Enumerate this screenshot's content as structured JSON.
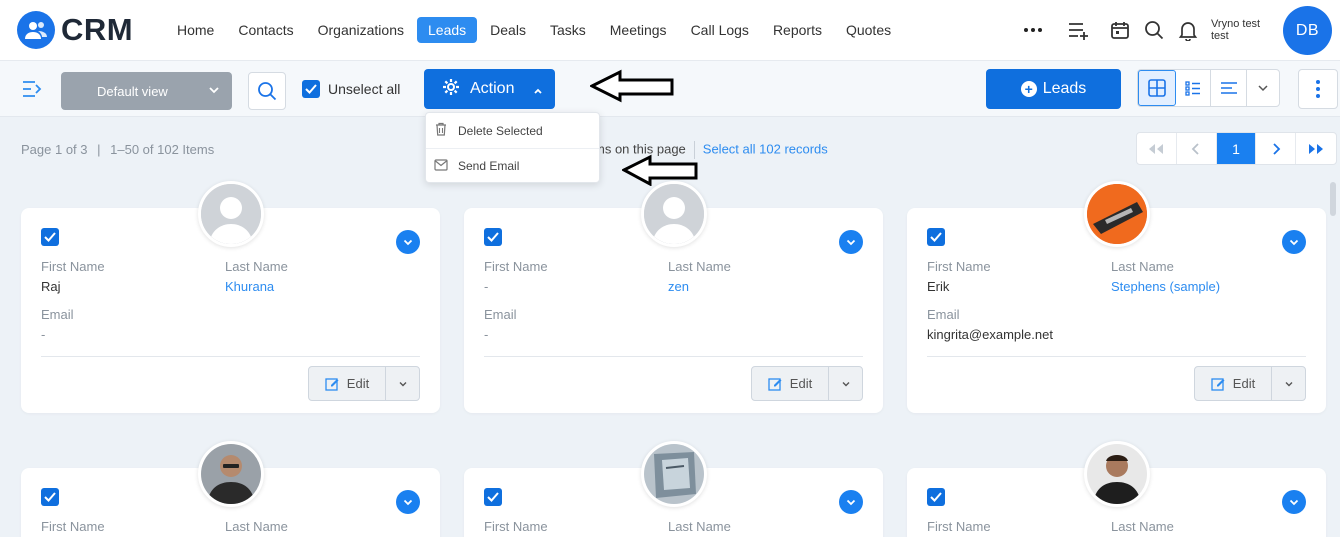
{
  "app": {
    "name": "CRM"
  },
  "nav": {
    "items": [
      "Home",
      "Contacts",
      "Organizations",
      "Leads",
      "Deals",
      "Tasks",
      "Meetings",
      "Call Logs",
      "Reports",
      "Quotes"
    ],
    "active": "Leads"
  },
  "user": {
    "name_line1": "Vryno test",
    "name_line2": "test",
    "initials": "DB"
  },
  "toolbar": {
    "view_select": "Default view",
    "unselect_label": "Unselect all",
    "action_label": "Action",
    "add_label": "Leads"
  },
  "action_menu": {
    "items": [
      "Delete Selected",
      "Send Email"
    ]
  },
  "info": {
    "page": "Page 1 of 3",
    "range": "1–50 of 102 Items",
    "selected_text": "ms on this page",
    "select_all_link": "Select all 102 records"
  },
  "pager": {
    "current": "1"
  },
  "labels": {
    "first_name": "First Name",
    "last_name": "Last Name",
    "email": "Email",
    "edit": "Edit"
  },
  "cards": [
    {
      "first_name": "Raj",
      "last_name": "Khurana",
      "email": "-"
    },
    {
      "first_name": "-",
      "last_name": "zen",
      "email": "-"
    },
    {
      "first_name": "Erik",
      "last_name": "Stephens (sample)",
      "email": "kingrita@example.net"
    },
    {
      "first_name": "",
      "last_name": "",
      "email": ""
    },
    {
      "first_name": "",
      "last_name": "",
      "email": ""
    },
    {
      "first_name": "",
      "last_name": "",
      "email": ""
    }
  ],
  "colors": {
    "primary": "#0f6fde",
    "accent_blue": "#2d8cf0",
    "muted": "#8a939d",
    "view_select_bg": "#9aa3ad"
  }
}
